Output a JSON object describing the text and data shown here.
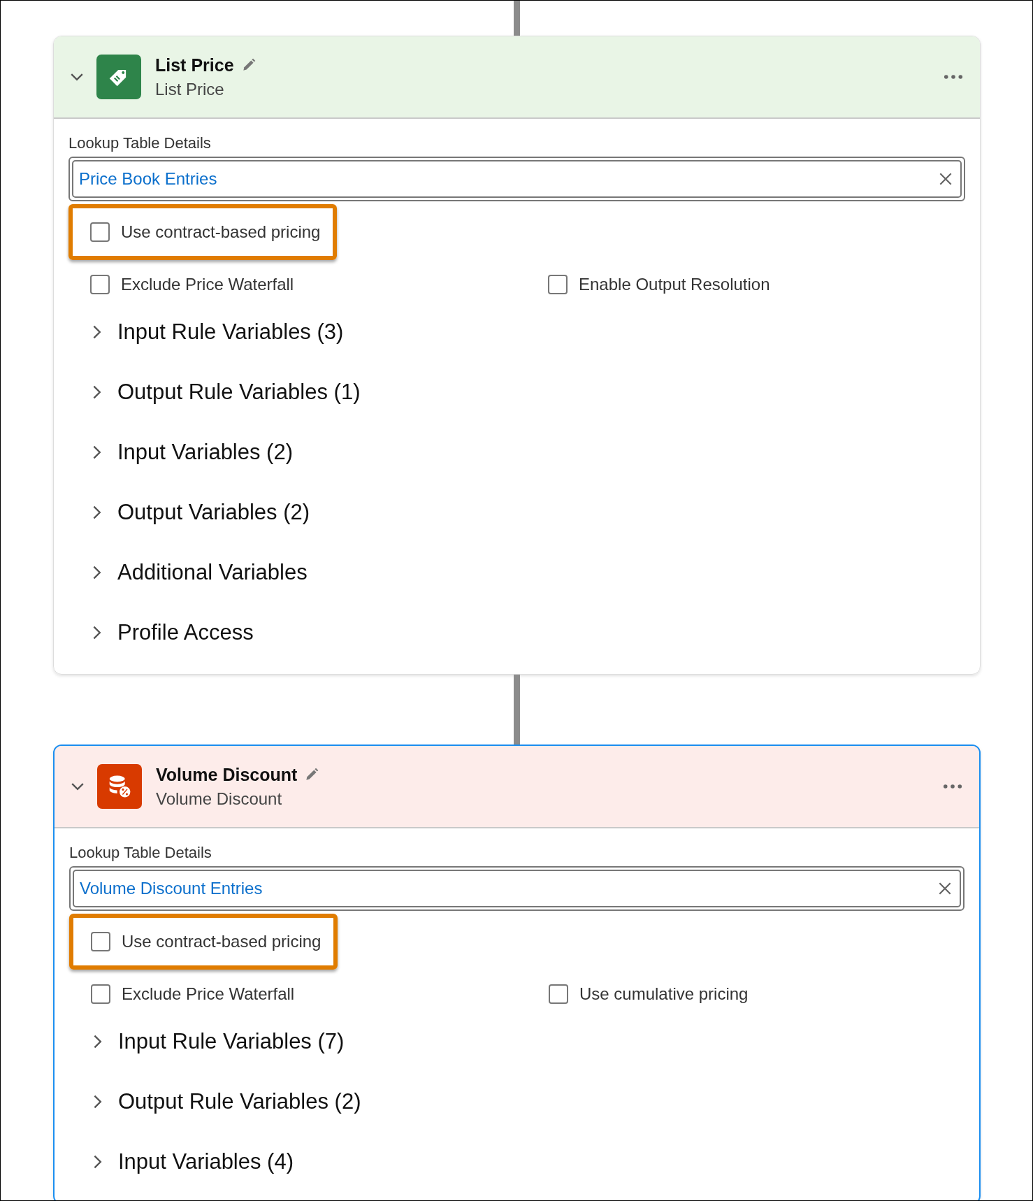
{
  "cards": [
    {
      "title": "List Price",
      "subtitle": "List Price",
      "kind": "tag",
      "color": "#2e844a",
      "selected": false,
      "expanded": true,
      "lookup_label": "Lookup Table Details",
      "lookup_value": "Price Book Entries",
      "options": [
        {
          "label": "Use contract-based pricing",
          "checked": false,
          "highlighted": true
        },
        {
          "label": "Exclude Price Waterfall",
          "checked": false,
          "highlighted": false
        },
        {
          "label": "Enable Output Resolution",
          "checked": false,
          "highlighted": false
        }
      ],
      "sections": [
        {
          "label": "Input Rule Variables (3)",
          "expanded": false
        },
        {
          "label": "Output Rule Variables (1)",
          "expanded": false
        },
        {
          "label": "Input Variables (2)",
          "expanded": false
        },
        {
          "label": "Output Variables (2)",
          "expanded": false
        },
        {
          "label": "Additional Variables",
          "expanded": false
        },
        {
          "label": "Profile Access",
          "expanded": false
        }
      ]
    },
    {
      "title": "Volume Discount",
      "subtitle": "Volume Discount",
      "kind": "database",
      "color": "#d83a00",
      "selected": true,
      "expanded": true,
      "lookup_label": "Lookup Table Details",
      "lookup_value": "Volume Discount Entries",
      "options": [
        {
          "label": "Use contract-based pricing",
          "checked": false,
          "highlighted": true
        },
        {
          "label": "Exclude Price Waterfall",
          "checked": false,
          "highlighted": false
        },
        {
          "label": "Use cumulative pricing",
          "checked": false,
          "highlighted": false
        }
      ],
      "sections": [
        {
          "label": "Input Rule Variables (7)",
          "expanded": false
        },
        {
          "label": "Output Rule Variables (2)",
          "expanded": false
        },
        {
          "label": "Input Variables (4)",
          "expanded": false
        }
      ]
    }
  ]
}
